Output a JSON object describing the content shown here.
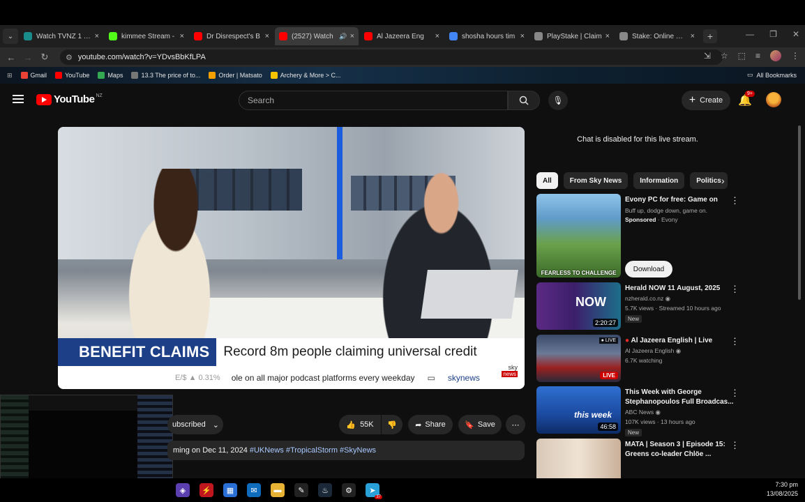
{
  "browser": {
    "tabs": [
      {
        "title": "Watch TVNZ 1 - F",
        "favicon_color": "#1a8c8c"
      },
      {
        "title": "kimmee Stream -",
        "favicon_color": "#53fc18"
      },
      {
        "title": "Dr Disrespect's B",
        "favicon_color": "#ff0000"
      },
      {
        "title": "(2527) Watch",
        "favicon_color": "#ff0000",
        "active": true
      },
      {
        "title": "Al Jazeera Eng",
        "favicon_color": "#ff0000"
      },
      {
        "title": "shosha hours tim",
        "favicon_color": "#4285f4"
      },
      {
        "title": "PlayStake | Claim",
        "favicon_color": "#888888"
      },
      {
        "title": "Stake: Online Cas",
        "favicon_color": "#888888"
      }
    ],
    "url": "youtube.com/watch?v=YDvsBbKfLPA",
    "bookmarks": [
      {
        "label": "Gmail",
        "color": "#ea4335"
      },
      {
        "label": "YouTube",
        "color": "#ff0000"
      },
      {
        "label": "Maps",
        "color": "#34a853"
      },
      {
        "label": "13.3 The price of to...",
        "color": "#777777"
      },
      {
        "label": "Order | Matsato",
        "color": "#f4a000"
      },
      {
        "label": "Archery & More > C...",
        "color": "#f4c400"
      }
    ],
    "all_bookmarks": "All Bookmarks"
  },
  "youtube": {
    "logo_text": "YouTube",
    "region": "NZ",
    "search_placeholder": "Search",
    "create_label": "Create",
    "notif_count": "9+"
  },
  "video": {
    "lower_third_tag": "BENEFIT CLAIMS",
    "lower_third_headline": "Record 8m people claiming universal credit",
    "ticker_market": "E/$ ▲ 0.31%",
    "ticker_text": "ole on all major podcast platforms every weekday",
    "ticker_site": "skynews",
    "sky_logo": "sky",
    "sky_logo_sub": "news"
  },
  "below_video": {
    "subscribed_label": "ubscribed",
    "like_count": "55K",
    "share_label": "Share",
    "save_label": "Save",
    "description_prefix": "ming on Dec 11, 2024",
    "description_tags": "#UKNews #TropicalStorm #SkyNews"
  },
  "sidebar": {
    "chat_disabled": "Chat is disabled for this live stream.",
    "chips": [
      "All",
      "From Sky News",
      "Information",
      "Politics"
    ],
    "recs": [
      {
        "title": "Evony PC for free: Game on",
        "line1": "Buff up, dodge down, game on.",
        "sponsored": "Sponsored",
        "channel": "Evony",
        "button": "Download",
        "thumb_text": "FEARLESS TO CHALLENGE"
      },
      {
        "title": "Herald NOW 11 August, 2025",
        "channel": "nzherald.co.nz",
        "meta": "5.7K views · Streamed 10 hours ago",
        "badge": "New",
        "duration": "2:20:27",
        "thumb_text": "NOW"
      },
      {
        "title": "Al Jazeera English | Live",
        "channel": "Al Jazeera English",
        "meta": "6.7K watching",
        "live": "LIVE"
      },
      {
        "title": "This Week with George Stephanopoulos Full Broadcas...",
        "channel": "ABC News",
        "meta": "107K views · 13 hours ago",
        "badge": "New",
        "duration": "46:58",
        "thumb_text": "this week"
      },
      {
        "title": "MATA | Season 3 | Episode 15: Greens co-leader Chlöe ..."
      }
    ]
  },
  "taskbar": {
    "time": "7:30 pm",
    "date": "13/08/2025",
    "steam_badge": "37"
  }
}
